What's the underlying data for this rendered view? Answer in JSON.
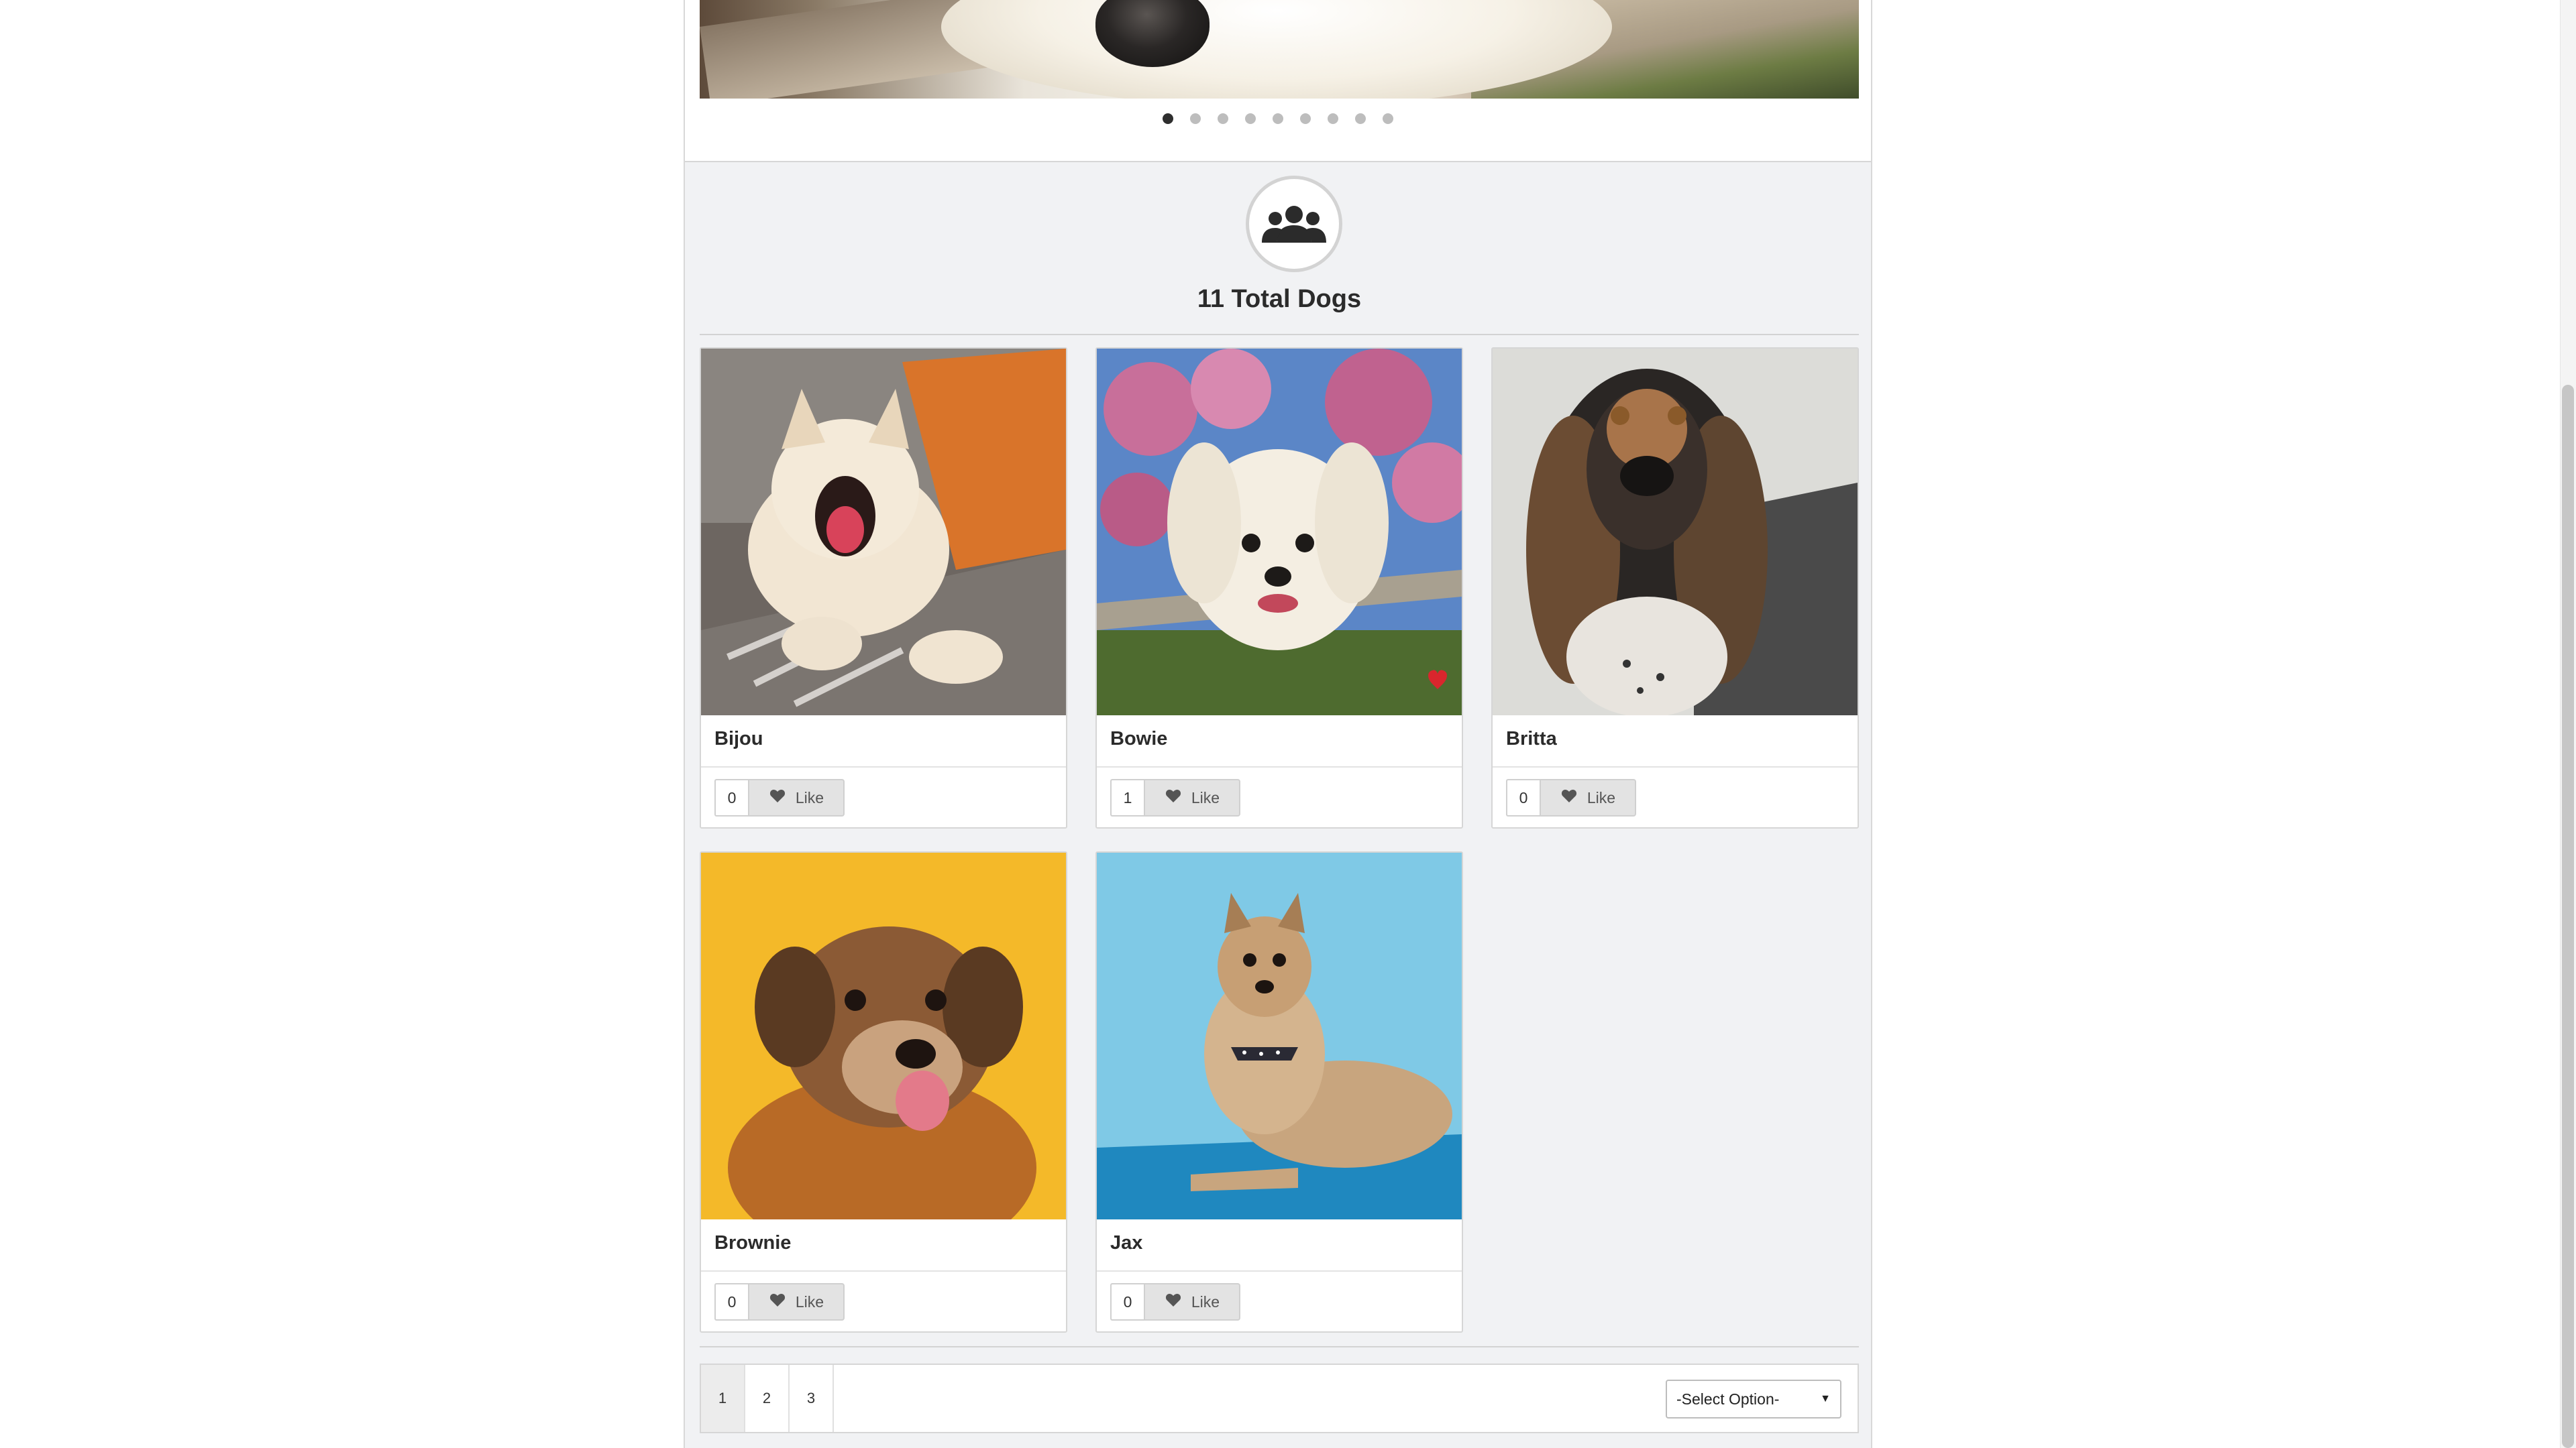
{
  "carousel": {
    "slide_count": 9,
    "active_slide": 1
  },
  "summary": {
    "icon": "users-group-icon",
    "title": "11 Total Dogs"
  },
  "dogs": [
    {
      "name": "Bijou",
      "likes": "0",
      "like_label": "Like"
    },
    {
      "name": "Bowie",
      "likes": "1",
      "like_label": "Like"
    },
    {
      "name": "Britta",
      "likes": "0",
      "like_label": "Like"
    },
    {
      "name": "Brownie",
      "likes": "0",
      "like_label": "Like"
    },
    {
      "name": "Jax",
      "likes": "0",
      "like_label": "Like"
    }
  ],
  "pagination": {
    "pages": [
      "1",
      "2",
      "3"
    ],
    "active_page": "1"
  },
  "sort_select": {
    "selected": "-Select Option-"
  },
  "colors": {
    "page_bg": "#f1f2f4",
    "card_bg": "#ffffff",
    "like_button_bg": "#e3e3e3",
    "heart_accent": "#d9262d"
  }
}
